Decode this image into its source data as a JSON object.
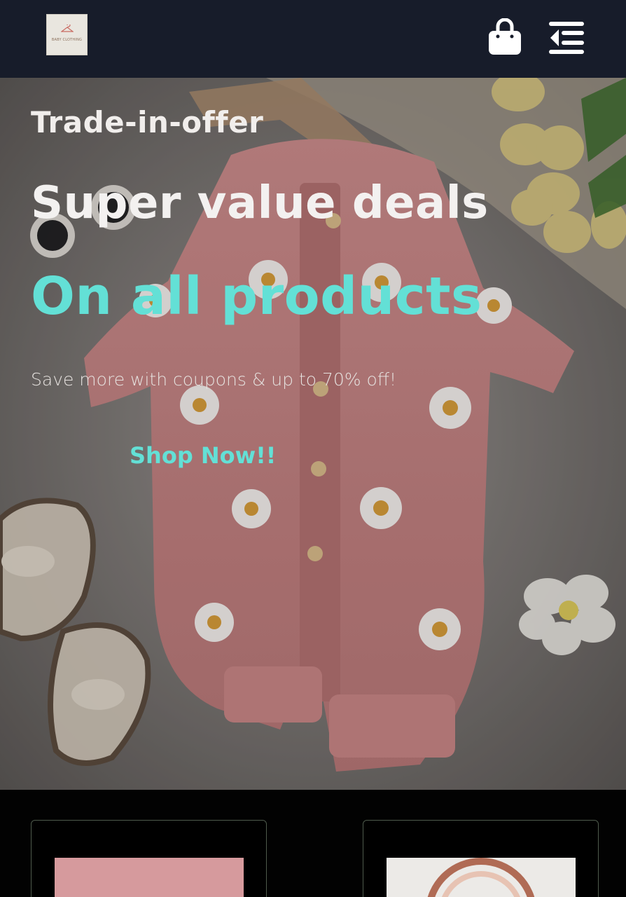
{
  "header": {
    "logo_text": "BABY CLOTHING",
    "bag_icon": "shopping-bag-icon",
    "menu_icon": "menu-collapse-icon"
  },
  "hero": {
    "kicker": "Trade-in-offer",
    "headline": "Super value deals",
    "headline_accent": "On all products",
    "subtext": "Save more with coupons & up to 70% off!",
    "cta_label": "Shop Now!!",
    "accent_color": "#63e0d6"
  },
  "product_cards": [
    {
      "image_color": "#d69a9d"
    },
    {
      "image_color": "#eceae7"
    }
  ]
}
